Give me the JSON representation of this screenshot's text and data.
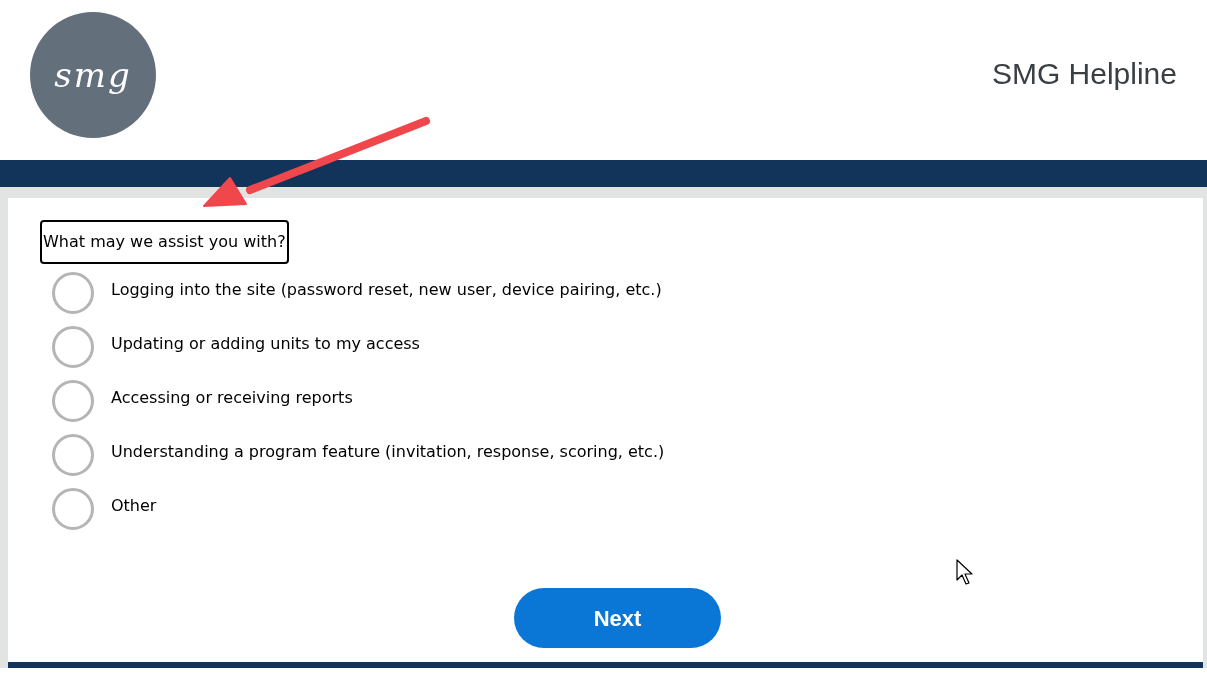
{
  "header": {
    "logo_text": "smg",
    "title": "SMG Helpline"
  },
  "question": {
    "label": "What may we assist you with?",
    "options": [
      {
        "label": "Logging into the site (password reset, new user, device pairing, etc.)",
        "selected": false
      },
      {
        "label": "Updating or adding units to my access",
        "selected": false
      },
      {
        "label": "Accessing or receiving reports",
        "selected": false
      },
      {
        "label": "Understanding a program feature (invitation, response, scoring, etc.)",
        "selected": false
      },
      {
        "label": "Other",
        "selected": false
      }
    ]
  },
  "next_button": {
    "label": "Next"
  }
}
